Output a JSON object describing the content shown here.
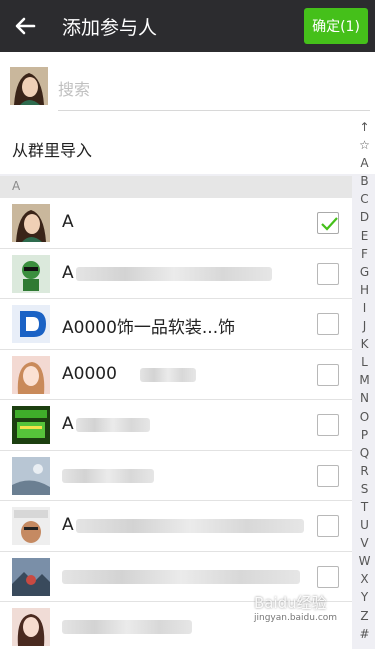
{
  "header": {
    "title": "添加参与人",
    "confirm_label": "确定(1)"
  },
  "search": {
    "placeholder": "搜索"
  },
  "import_label": "从群里导入",
  "section_letter": "A",
  "contacts": [
    {
      "name": "A",
      "checked": true
    },
    {
      "name": "A",
      "checked": false
    },
    {
      "name": "A0000饰一品软装...饰",
      "checked": false
    },
    {
      "name": "A0000",
      "checked": false
    },
    {
      "name": "A",
      "checked": false
    },
    {
      "name": "",
      "checked": false
    },
    {
      "name": "A",
      "checked": false
    },
    {
      "name": "",
      "checked": false
    },
    {
      "name": "",
      "checked": false
    }
  ],
  "index_letters": [
    "↑",
    "☆",
    "A",
    "B",
    "C",
    "D",
    "E",
    "F",
    "G",
    "H",
    "I",
    "J",
    "K",
    "L",
    "M",
    "N",
    "O",
    "P",
    "Q",
    "R",
    "S",
    "T",
    "U",
    "V",
    "W",
    "X",
    "Y",
    "Z",
    "#"
  ],
  "watermark": {
    "text": "Baidu经验",
    "sub": "jingyan.baidu.com"
  },
  "colors": {
    "titlebar": "#2c2c2f",
    "accent": "#45c01a"
  }
}
